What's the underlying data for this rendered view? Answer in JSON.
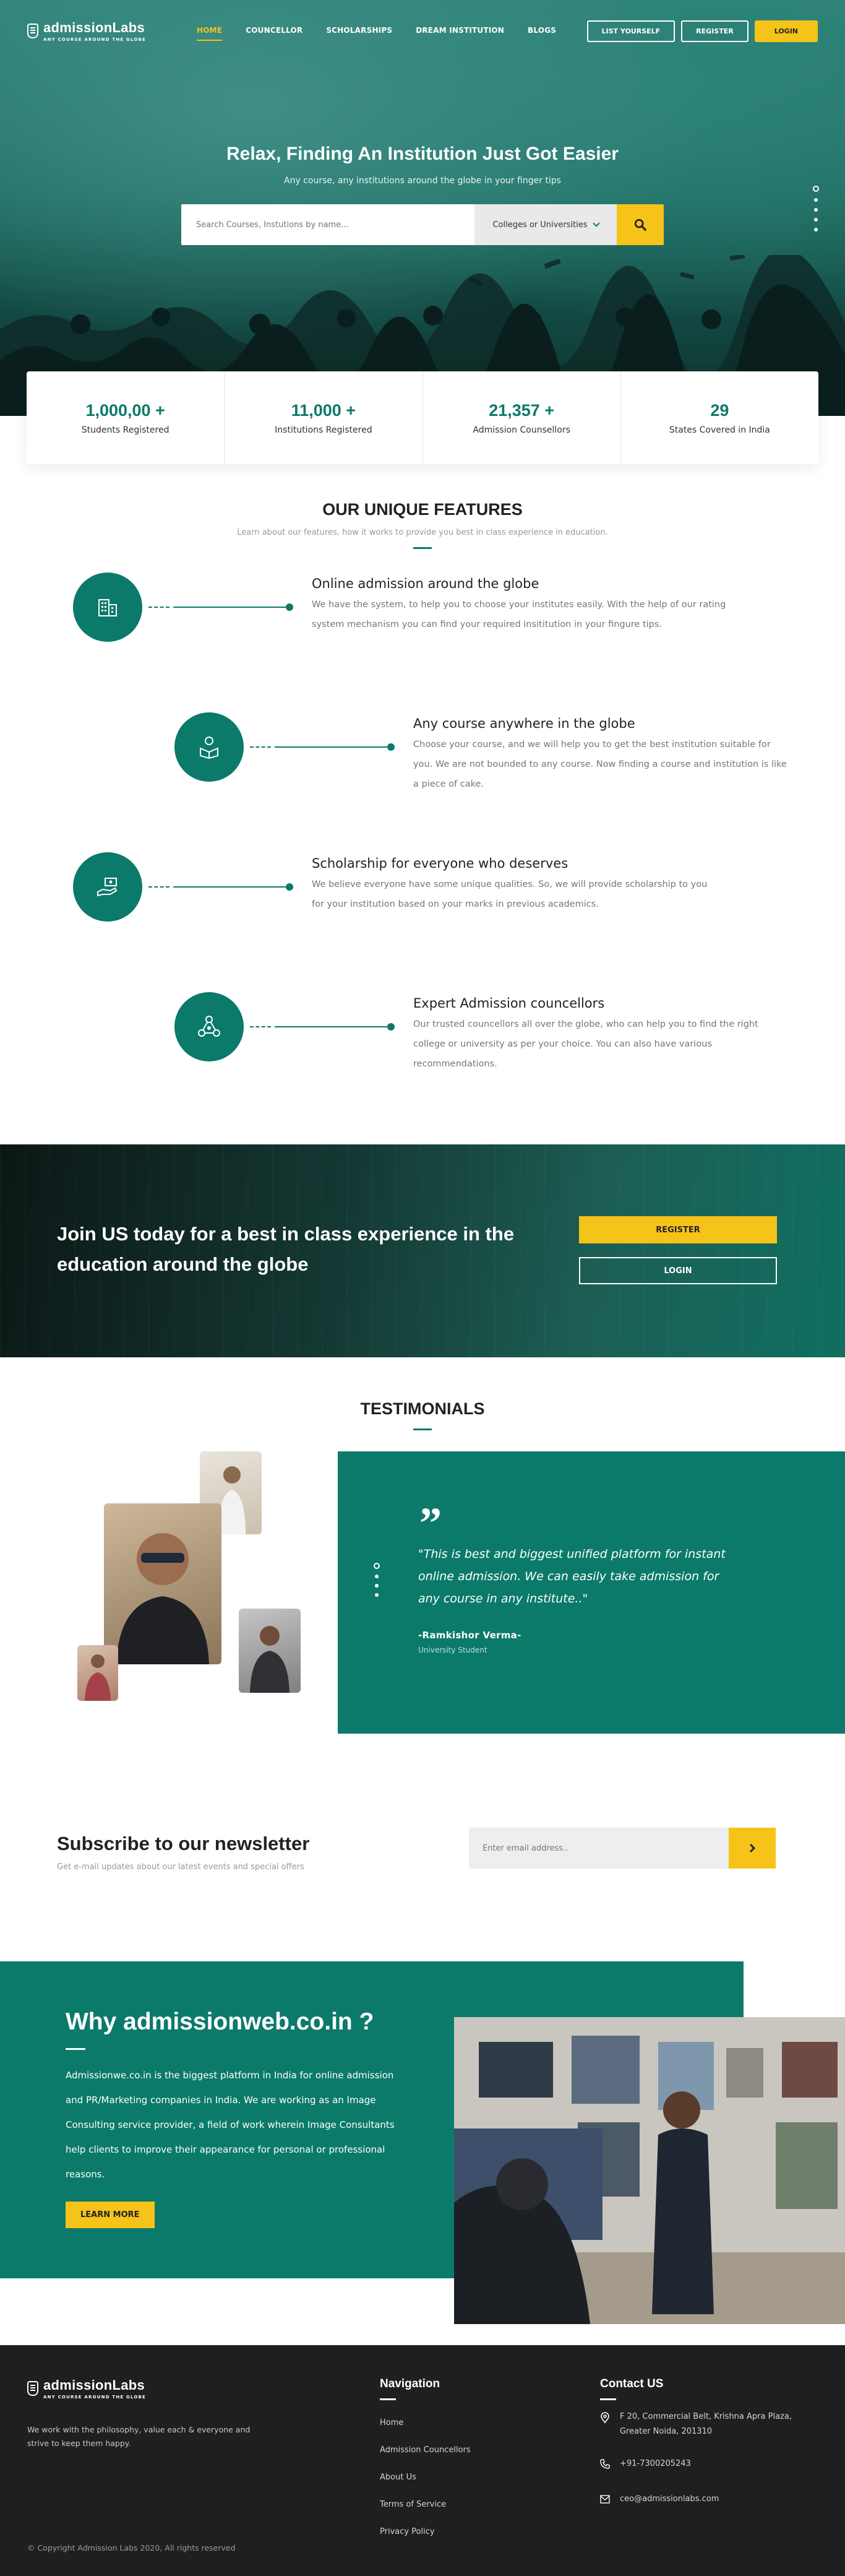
{
  "brand": {
    "name": "admissionLabs",
    "tagline": "ANY COURSE AROUND THE GLOBE"
  },
  "nav": {
    "items": [
      "HOME",
      "COUNCELLOR",
      "SCHOLARSHIPS",
      "DREAM INSTITUTION",
      "BLOGS"
    ],
    "active": "HOME",
    "list_yourself": "LIST YOURSELF",
    "register": "REGISTER",
    "login": "LOGIN"
  },
  "hero": {
    "title": "Relax, Finding An Institution Just Got Easier",
    "subtitle": "Any course, any institutions around the globe in your finger tips",
    "search_placeholder": "Search Courses, Instutions by name...",
    "search_select": "Colleges or Universities",
    "slider_dots": 5,
    "active_dot": 1
  },
  "stats": [
    {
      "value": "1,000,00 +",
      "label": "Students Registered"
    },
    {
      "value": "11,000 +",
      "label": "Institutions Registered"
    },
    {
      "value": "21,357 +",
      "label": "Admission Counsellors"
    },
    {
      "value": "29",
      "label": "States Covered in India"
    }
  ],
  "features": {
    "title": "OUR UNIQUE FEATURES",
    "subtitle": "Learn about our features, how it works to provide you best in class experience in education.",
    "items": [
      {
        "icon": "building-icon",
        "title": "Online admission around the globe",
        "text": "We have the system, to help you to choose your institutes easily. With the help of our rating system mechanism you can find your required insititution in your fingure tips."
      },
      {
        "icon": "student-book-icon",
        "title": "Any course anywhere in the globe",
        "text": "Choose your course, and we will help you to get the best institution suitable for you. We are not bounded to any course. Now finding a course and institution is like a piece of cake."
      },
      {
        "icon": "hand-money-icon",
        "title": "Scholarship for everyone who deserves",
        "text": "We believe everyone have some unique qualities. So, we will provide scholarship to you for your institution based on your marks in previous academics."
      },
      {
        "icon": "people-network-icon",
        "title": "Expert Admission councellors",
        "text": "Our trusted councellors all over the globe, who can help you to find the right college or university as per your choice. You can also have various recommendations."
      }
    ]
  },
  "cta": {
    "text": "Join US today for a best in class experience in the education around the globe",
    "register": "REGISTER",
    "login": "LOGIN"
  },
  "testimonials": {
    "title": "TESTIMONIALS",
    "quote": "\"This is best and biggest unified platform for instant online admission. We can easily take admission for any course in any institute..\"",
    "author": "-Ramkishor Verma-",
    "role": "University Student",
    "dots": 4,
    "active_dot": 0
  },
  "newsletter": {
    "title": "Subscribe to our newsletter",
    "subtitle": "Get e-mail updates about our latest events and special offers",
    "placeholder": "Enter email address.."
  },
  "why": {
    "title": "Why admissionweb.co.in ?",
    "text": "Admissionwe.co.in is the biggest platform in India for online admission and PR/Marketing companies in India. We are working as an Image Consulting service provider, a field of work wherein Image Consultants help clients to improve their appearance for personal or professional reasons.",
    "button": "LEARN MORE"
  },
  "footer": {
    "about": "We work with the philosophy, value each & everyone and strive to keep them happy.",
    "copyright": "© Copyright Admission Labs 2020, All rights reserved",
    "nav_title": "Navigation",
    "nav_links": [
      "Home",
      "Admission Councellors",
      "About Us",
      "Terms of Service",
      "Privacy Policy"
    ],
    "contact_title": "Contact US",
    "address": "F 20, Commercial Belt, Krishna Apra Plaza, Greater Noida, 201310",
    "phone": "+91-7300205243",
    "email": "ceo@admissionlabs.com"
  },
  "colors": {
    "primary": "#0b7a6a",
    "accent": "#f6c319",
    "footer_bg": "#1d1f21"
  }
}
